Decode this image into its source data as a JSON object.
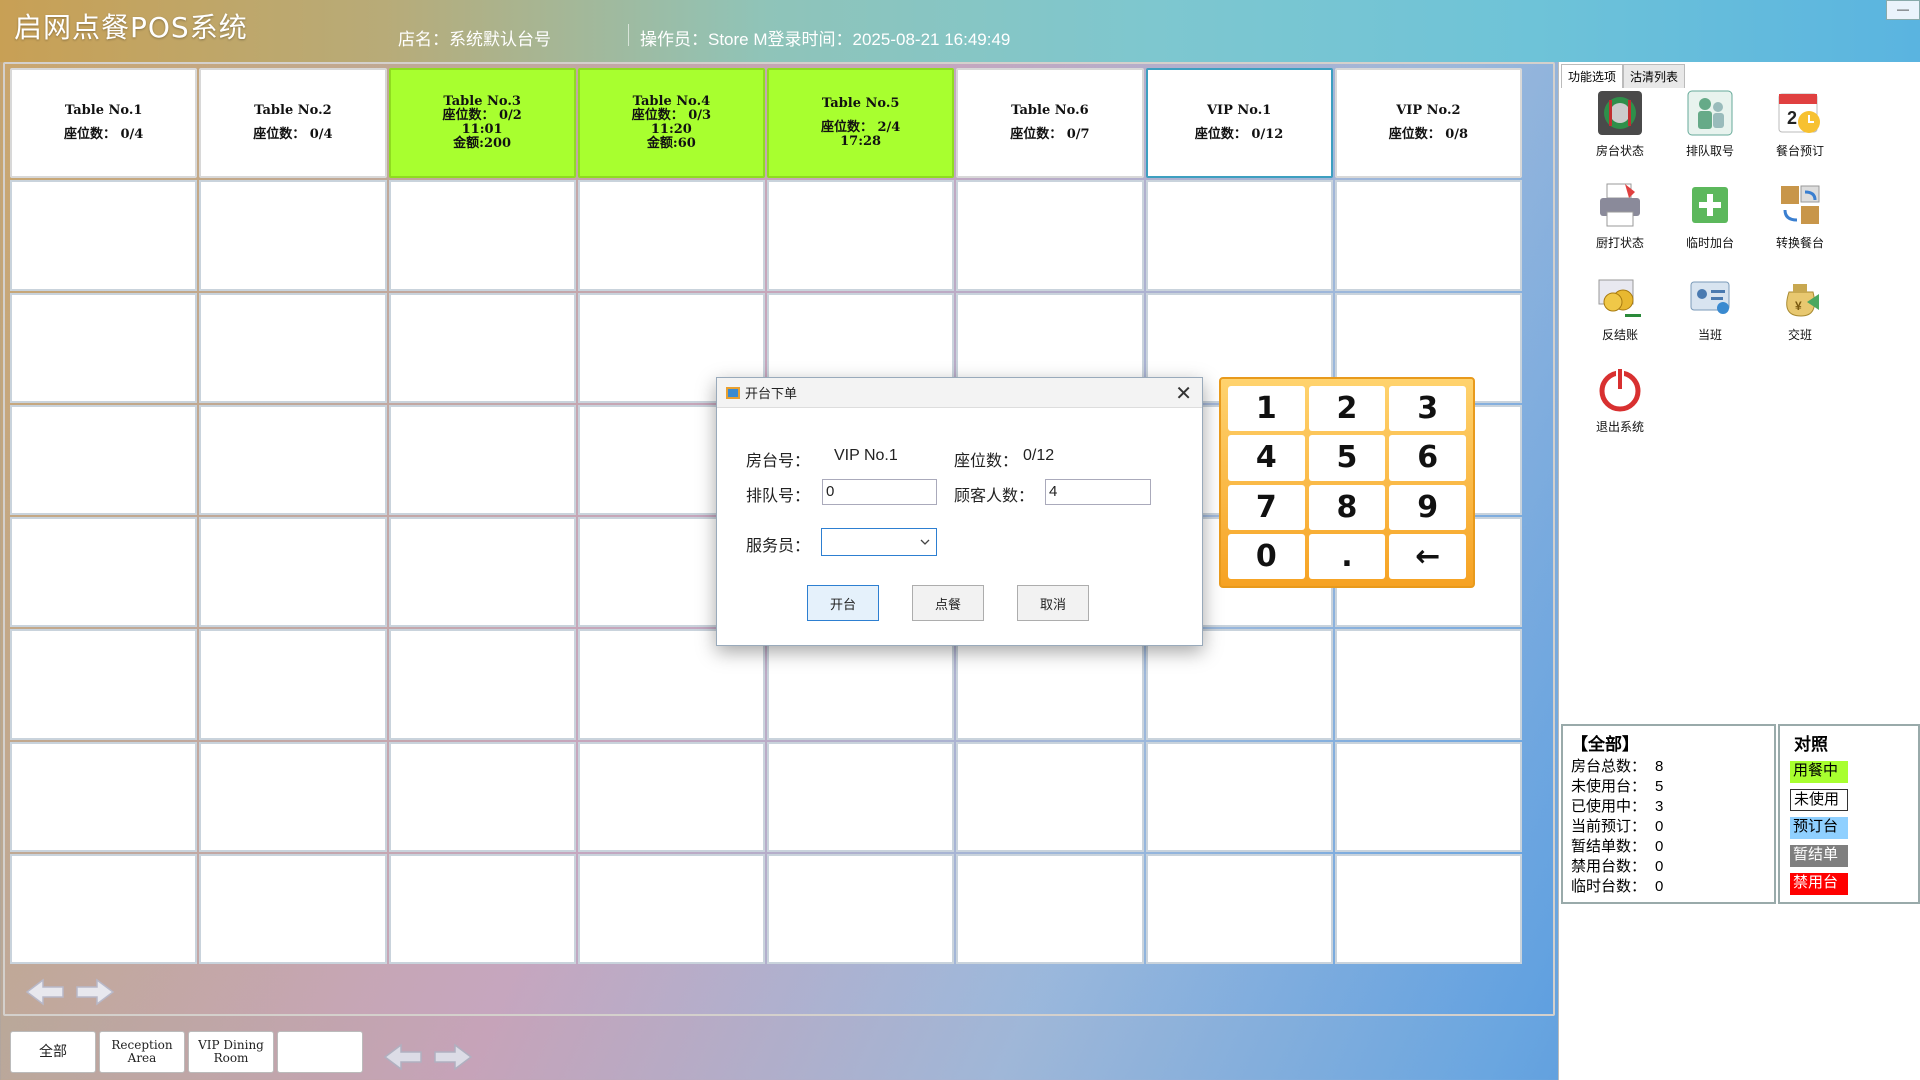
{
  "app": {
    "title": "启网点餐POS系统",
    "store": "店名：系统默认台号",
    "operator": "操作员：Store M登录时间：2025-08-21 16:49:49"
  },
  "tables": [
    {
      "name": "Table No.1",
      "seats": "座位数： 0/4",
      "status": "free"
    },
    {
      "name": "Table No.2",
      "seats": "座位数： 0/4",
      "status": "free"
    },
    {
      "name": "Table No.3",
      "seats": "座位数： 0/2",
      "time": "11:01",
      "amount": "金额:200",
      "status": "busy"
    },
    {
      "name": "Table No.4",
      "seats": "座位数： 0/3",
      "time": "11:20",
      "amount": "金额:60",
      "status": "busy"
    },
    {
      "name": "Table No.5",
      "seats": "座位数： 2/4",
      "time": "17:28",
      "status": "busy"
    },
    {
      "name": "Table No.6",
      "seats": "座位数： 0/7",
      "status": "free"
    },
    {
      "name": "VIP No.1",
      "seats": "座位数： 0/12",
      "status": "selected"
    },
    {
      "name": "VIP No.2",
      "seats": "座位数： 0/8",
      "status": "free"
    }
  ],
  "bottom_tabs": [
    "全部",
    "Reception Area",
    "VIP Dining Room",
    ""
  ],
  "side": {
    "tabs": [
      "功能选项",
      "沽清列表"
    ],
    "functions": [
      "房台状态",
      "排队取号",
      "餐台预订",
      "厨打状态",
      "临时加台",
      "转换餐台",
      "反结账",
      "当班",
      "交班",
      "退出系统"
    ]
  },
  "stats": {
    "header": "【全部】",
    "rows": [
      {
        "label": "房台总数：",
        "value": "8"
      },
      {
        "label": "未使用台：",
        "value": "5"
      },
      {
        "label": "已使用中：",
        "value": "3"
      },
      {
        "label": "当前预订：",
        "value": "0"
      },
      {
        "label": "暂结单数：",
        "value": "0"
      },
      {
        "label": "禁用台数：",
        "value": "0"
      },
      {
        "label": "临时台数：",
        "value": "0"
      }
    ]
  },
  "legend": {
    "header": "对照",
    "items": [
      {
        "label": "用餐中",
        "color": "#a8ff2f"
      },
      {
        "label": "未使用",
        "color": "#ffffff"
      },
      {
        "label": "预订台",
        "color": "#8fd0ff"
      },
      {
        "label": "暂结单",
        "color": "#7f7f7f"
      },
      {
        "label": "禁用台",
        "color": "#ff0000"
      }
    ]
  },
  "dialog": {
    "title": "开台下单",
    "room_label": "房台号：",
    "room_value": "VIP No.1",
    "seats_label": "座位数：",
    "seats_value": "0/12",
    "queue_label": "排队号：",
    "queue_value": "0",
    "guests_label": "顾客人数：",
    "guests_value": "4",
    "waiter_label": "服务员：",
    "waiter_value": "",
    "open_btn": "开台",
    "order_btn": "点餐",
    "cancel_btn": "取消"
  },
  "keypad": [
    "1",
    "2",
    "3",
    "4",
    "5",
    "6",
    "7",
    "8",
    "9",
    "0",
    ".",
    "←"
  ]
}
